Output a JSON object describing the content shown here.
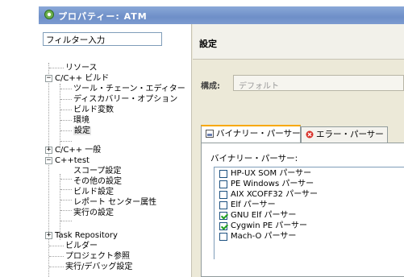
{
  "window": {
    "title": "プロパティー: ATM"
  },
  "filter": {
    "text": "フィルター入力"
  },
  "tree": {
    "items": [
      {
        "label": "リソース"
      },
      {
        "label": "C/C++ ビルド"
      },
      {
        "label": "ツール・チェーン・エディター"
      },
      {
        "label": "ディスカバリー・オプション"
      },
      {
        "label": "ビルド変数"
      },
      {
        "label": "環境"
      },
      {
        "label": "設定"
      },
      {
        "label": "C/C++ 一般"
      },
      {
        "label": "C++test"
      },
      {
        "label": "スコープ設定"
      },
      {
        "label": "その他の設定"
      },
      {
        "label": "ビルド設定"
      },
      {
        "label": "レポート センター属性"
      },
      {
        "label": "実行の設定"
      },
      {
        "label": "Task Repository"
      },
      {
        "label": "ビルダー"
      },
      {
        "label": "プロジェクト参照"
      },
      {
        "label": "実行/デバッグ設定"
      }
    ],
    "selected": "設定"
  },
  "page": {
    "title": "設定",
    "config_label": "構成:",
    "config_value": "デフォルト"
  },
  "tabs": [
    {
      "label": "バイナリー・パーサー",
      "active": true
    },
    {
      "label": "エラー・パーサー",
      "active": false
    }
  ],
  "binary_parsers": {
    "label": "バイナリー・パーサー:",
    "items": [
      {
        "label": "HP-UX SOM パーサー",
        "checked": false
      },
      {
        "label": "PE Windows パーサー",
        "checked": false
      },
      {
        "label": "AIX XCOFF32 パーサー",
        "checked": false
      },
      {
        "label": "Elf パーサー",
        "checked": false
      },
      {
        "label": "GNU Elf パーサー",
        "checked": true
      },
      {
        "label": "Cygwin PE パーサー",
        "checked": true
      },
      {
        "label": "Mach-O パーサー",
        "checked": false
      }
    ]
  },
  "icons": {
    "title": "gear-icon",
    "binary_tab": "binary-file-icon",
    "error_tab": "error-icon"
  }
}
